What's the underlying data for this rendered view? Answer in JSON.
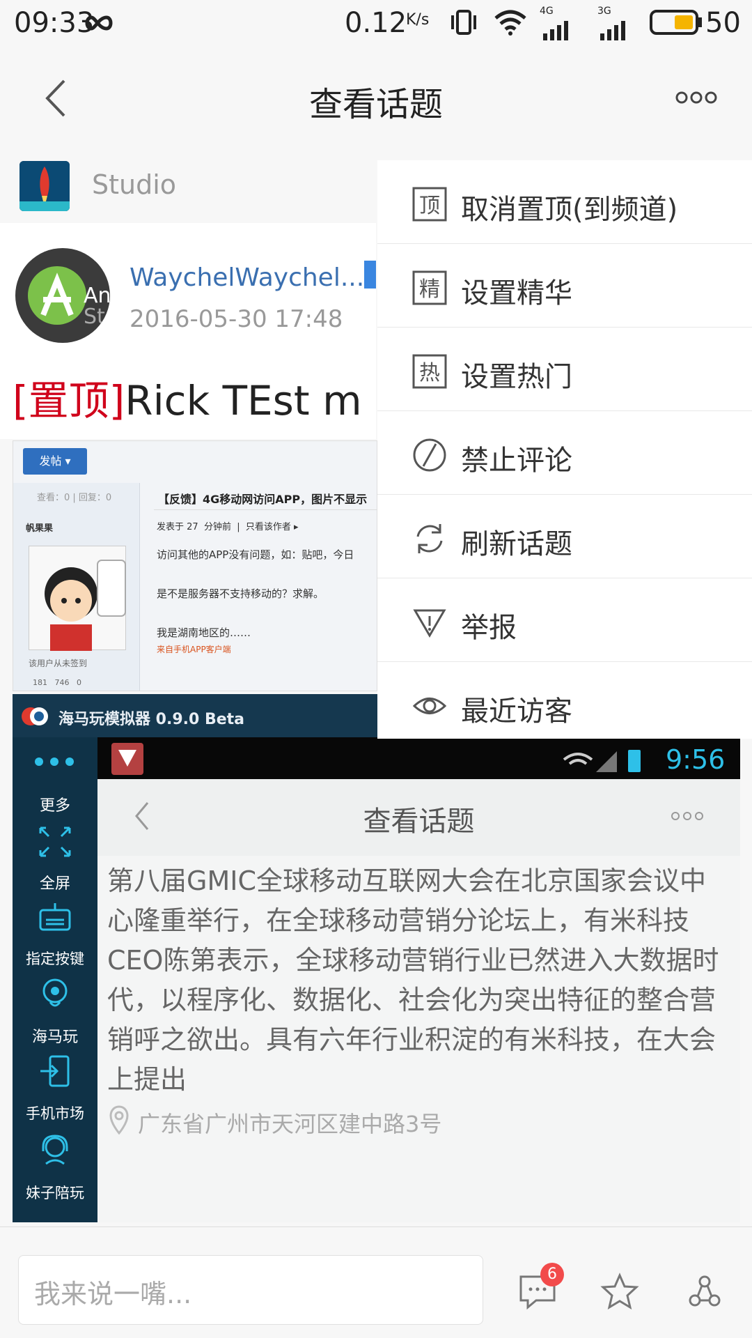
{
  "status": {
    "time": "09:33",
    "net_speed": "0.12",
    "net_speed_unit": "K/s",
    "signal_4g": "4G",
    "signal_3g": "3G",
    "battery": "50"
  },
  "header": {
    "title": "查看话题"
  },
  "channel": {
    "name": "Studio"
  },
  "post": {
    "author": "WaychelWaychel...",
    "date": "2016-05-30 17:48",
    "tag": "[置顶]",
    "title": "Rick TEst m",
    "avatar_text": "An\nSt"
  },
  "menu": {
    "items": [
      {
        "icon_text": "顶",
        "label": "取消置顶(到频道)"
      },
      {
        "icon_text": "精",
        "label": "设置精华"
      },
      {
        "icon_text": "热",
        "label": "设置热门"
      },
      {
        "icon_text": "",
        "label": "禁止评论"
      },
      {
        "icon_text": "",
        "label": "刷新话题"
      },
      {
        "icon_text": "",
        "label": "举报"
      },
      {
        "icon_text": "",
        "label": "最近访客"
      }
    ]
  },
  "screenshot1": {
    "post_button": "发帖 ▾",
    "stats": "查看：0 | 回复：0",
    "username": "帆果果",
    "thread_title": "【反馈】4G移动网访问APP，图片不显示",
    "meta": "发表于 27  分钟前  |  只看该作者 ▸",
    "line1": "访问其他的APP没有问题，如：贴吧，今日",
    "line2": "是不是服务器不支持移动的？求解。",
    "line3": "我是湖南地区的……",
    "source": "来自手机APP客户端",
    "not_signed": "该用户从未签到",
    "counts": "181   746   0"
  },
  "screenshot2": {
    "emulator_title": "海马玩模拟器 0.9.0 Beta",
    "clock": "9:56",
    "inner_title": "查看话题",
    "side_items": [
      "更多",
      "全屏",
      "指定按键",
      "海马玩",
      "手机市场",
      "妹子陪玩"
    ],
    "content": "第八届GMIC全球移动互联网大会在北京国家会议中心隆重举行，在全球移动营销分论坛上，有米科技CEO陈第表示，全球移动营销行业已然进入大数据时代，以程序化、数据化、社会化为突出特征的整合营销呼之欲出。具有六年行业积淀的有米科技，在大会上提出",
    "location": "广东省广州市天河区建中路3号"
  },
  "bottom": {
    "input_placeholder": "我来说一嘴...",
    "comment_badge": "6"
  },
  "colors": {
    "accent": "#3a6fb0",
    "tag_red": "#d0021b",
    "badge": "#f24b4b"
  }
}
